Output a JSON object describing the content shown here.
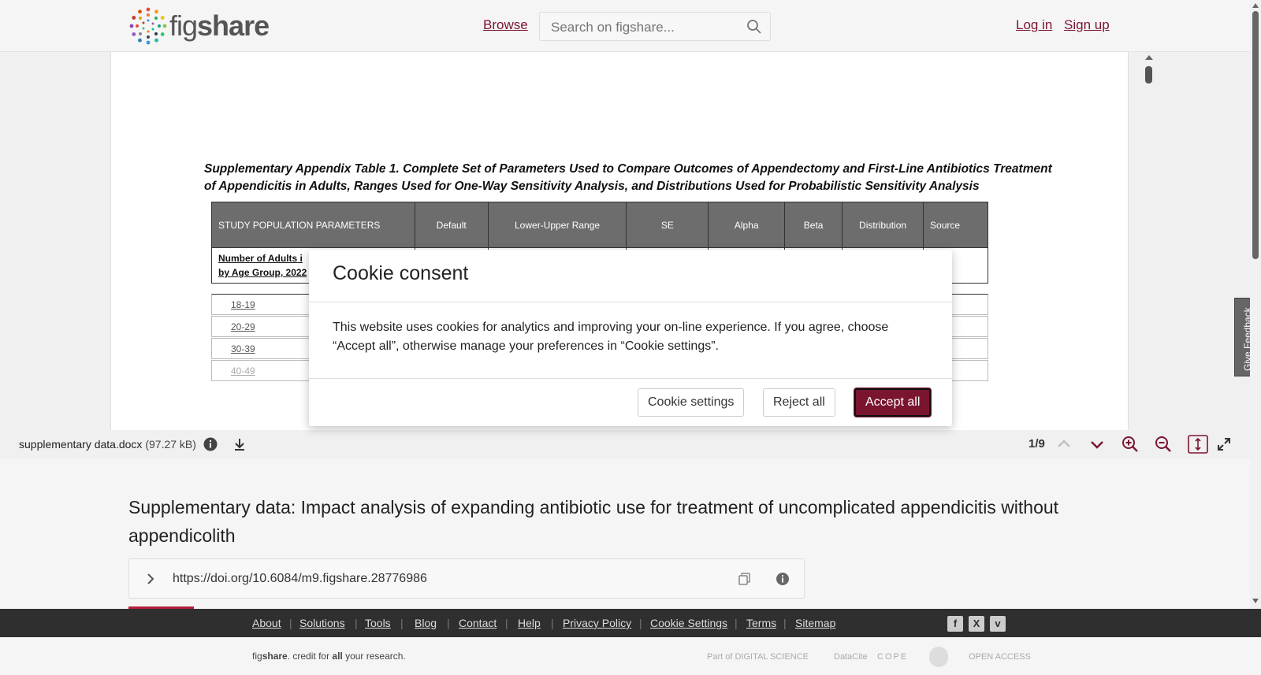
{
  "header": {
    "logo_prefix": "fig",
    "logo_suffix": "share",
    "browse_label": "Browse",
    "search_placeholder": "Search on figshare...",
    "login_label": "Log in",
    "signup_label": "Sign up"
  },
  "document": {
    "title": "Supplementary Appendix Table 1. Complete Set of Parameters Used to Compare Outcomes of Appendectomy and First-Line Antibiotics Treatment of Appendicitis in Adults, Ranges Used for One-Way Sensitivity Analysis, and Distributions Used for Probabilistic Sensitivity Analysis",
    "columns": [
      "STUDY POPULATION PARAMETERS",
      "Default",
      "Lower-Upper Range",
      "SE",
      "Alpha",
      "Beta",
      "Distribution",
      "Source"
    ],
    "first_row": "Number of Adults i\nby Age Group, 2022",
    "age_rows": [
      "18-19",
      "20-29",
      "30-39",
      "40-49"
    ]
  },
  "feedback_label": "Give Feedback",
  "file_bar": {
    "file_name": "supplementary data.docx",
    "file_size": "(97.27 kB)",
    "page_count": "1/9"
  },
  "item": {
    "title": "Supplementary data: Impact analysis of expanding antibiotic use for treatment of uncomplicated appendicitis without appendicolith",
    "doi": "https://doi.org/10.6084/m9.figshare.28776986"
  },
  "modal": {
    "title": "Cookie consent",
    "body": "This website uses cookies for analytics and improving your on-line experience. If you agree, choose “Accept all”, otherwise manage your preferences in “Cookie settings”.",
    "settings_label": "Cookie settings",
    "reject_label": "Reject all",
    "accept_label": "Accept all"
  },
  "footer": {
    "links": [
      "About",
      "Solutions",
      "Tools",
      "Blog",
      "Contact",
      "Help",
      "Privacy Policy",
      "Cookie Settings",
      "Terms",
      "Sitemap"
    ],
    "credit_prefix": "fig",
    "credit_brand": "share",
    "credit_middle": ". credit for ",
    "credit_all": "all",
    "credit_end": " your research.",
    "partners": [
      "Part of DIGITAL SCIENCE",
      "DataCite",
      "COPE",
      "",
      "OPEN ACCESS"
    ]
  },
  "colors": {
    "brand": "#7a1530",
    "footer_bg": "#2f2f2f"
  },
  "icons": [
    "figshare-logo-icon",
    "search-icon",
    "info-icon",
    "download-icon",
    "chevron-up-icon",
    "chevron-down-icon",
    "zoom-in-icon",
    "zoom-out-icon",
    "fit-height-icon",
    "fullscreen-icon",
    "chevron-right-icon",
    "copy-icon",
    "facebook-icon",
    "x-icon",
    "vimeo-icon"
  ]
}
